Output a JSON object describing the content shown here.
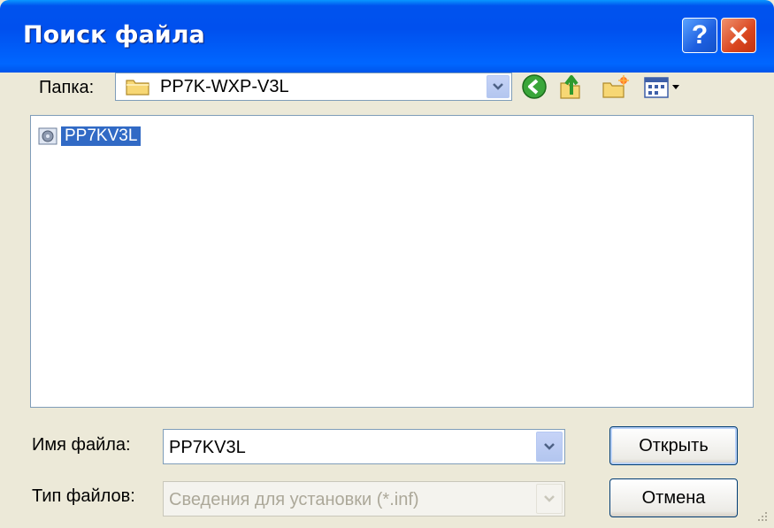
{
  "window": {
    "title": "Поиск файла",
    "help_label": "?"
  },
  "toolbar": {
    "folder_label": "Папка:",
    "folder_value": "PP7K-WXP-V3L",
    "icons": [
      "folder-icon",
      "back-icon",
      "up-folder-icon",
      "new-folder-icon",
      "views-menu-icon"
    ]
  },
  "file_list": {
    "items": [
      {
        "name": "PP7KV3L",
        "selected": true,
        "icon": "setup-info-file-icon"
      }
    ]
  },
  "form": {
    "filename_label": "Имя файла:",
    "filename_value": "PP7KV3L",
    "filetype_label": "Тип файлов:",
    "filetype_value": "Сведения для установки (*.inf)"
  },
  "buttons": {
    "open_label": "Открыть",
    "cancel_label": "Отмена"
  },
  "colors": {
    "titlebar": "#0053ee",
    "selection": "#316ac5",
    "dialog_bg": "#ece9d8"
  }
}
